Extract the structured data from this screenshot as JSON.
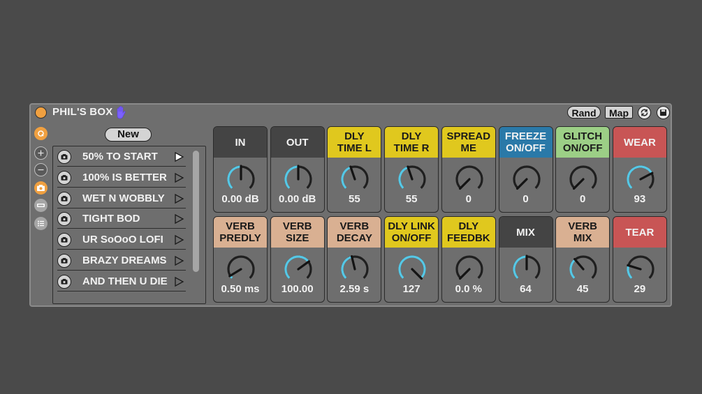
{
  "device": {
    "title": "PHIL'S BOX",
    "rand_label": "Rand",
    "map_label": "Map"
  },
  "icons": {
    "power": "power-icon",
    "hand": "hand-icon",
    "sync": "sync-icon",
    "save": "save-icon",
    "hand_color": "#7b61ff",
    "accent": "#f0a040",
    "knob_arc": "#56c8e6"
  },
  "presets": {
    "new_label": "New",
    "items": [
      {
        "label": "50% TO START",
        "active": true
      },
      {
        "label": "100% IS BETTER",
        "active": false
      },
      {
        "label": "WET N WOBBLY",
        "active": false
      },
      {
        "label": "TIGHT BOD",
        "active": false
      },
      {
        "label": "UR SoOoO LOFI",
        "active": false
      },
      {
        "label": "BRAZY DREAMS",
        "active": false
      },
      {
        "label": "AND THEN U DIE",
        "active": false
      }
    ]
  },
  "knobs": [
    {
      "label": "IN",
      "value": "0.00 dB",
      "level": 0.5,
      "head": "#444444",
      "text": "#f2f2f2"
    },
    {
      "label": "OUT",
      "value": "0.00 dB",
      "level": 0.5,
      "head": "#444444",
      "text": "#f2f2f2"
    },
    {
      "label": "DLY\nTIME L",
      "value": "55",
      "level": 0.43,
      "head": "#e0c81e",
      "text": "#1a1a1a"
    },
    {
      "label": "DLY\nTIME R",
      "value": "55",
      "level": 0.43,
      "head": "#e0c81e",
      "text": "#1a1a1a"
    },
    {
      "label": "SPREAD\nME",
      "value": "0",
      "level": 0.0,
      "head": "#e0c81e",
      "text": "#1a1a1a"
    },
    {
      "label": "FREEZE\nON/OFF",
      "value": "0",
      "level": 0.0,
      "head": "#2a79a8",
      "text": "#f2f2f2"
    },
    {
      "label": "GLITCH\nON/OFF",
      "value": "0",
      "level": 0.0,
      "head": "#9ccf86",
      "text": "#1a1a1a"
    },
    {
      "label": "WEAR",
      "value": "93",
      "level": 0.73,
      "head": "#c85555",
      "text": "#f2f2f2"
    },
    {
      "label": "VERB\nPREDLY",
      "value": "0.50 ms",
      "level": 0.05,
      "head": "#d9b092",
      "text": "#1a1a1a"
    },
    {
      "label": "VERB\nSIZE",
      "value": "100.00",
      "level": 0.7,
      "head": "#d9b092",
      "text": "#1a1a1a"
    },
    {
      "label": "VERB\nDECAY",
      "value": "2.59 s",
      "level": 0.45,
      "head": "#d9b092",
      "text": "#1a1a1a"
    },
    {
      "label": "DLY LINK\nON/OFF",
      "value": "127",
      "level": 1.0,
      "head": "#e0c81e",
      "text": "#1a1a1a"
    },
    {
      "label": "DLY\nFEEDBK",
      "value": "0.0 %",
      "level": 0.0,
      "head": "#e0c81e",
      "text": "#1a1a1a"
    },
    {
      "label": "MIX",
      "value": "64",
      "level": 0.5,
      "head": "#444444",
      "text": "#f2f2f2"
    },
    {
      "label": "VERB\nMIX",
      "value": "45",
      "level": 0.35,
      "head": "#d9b092",
      "text": "#1a1a1a"
    },
    {
      "label": "TEAR",
      "value": "29",
      "level": 0.23,
      "head": "#c85555",
      "text": "#f2f2f2"
    }
  ]
}
